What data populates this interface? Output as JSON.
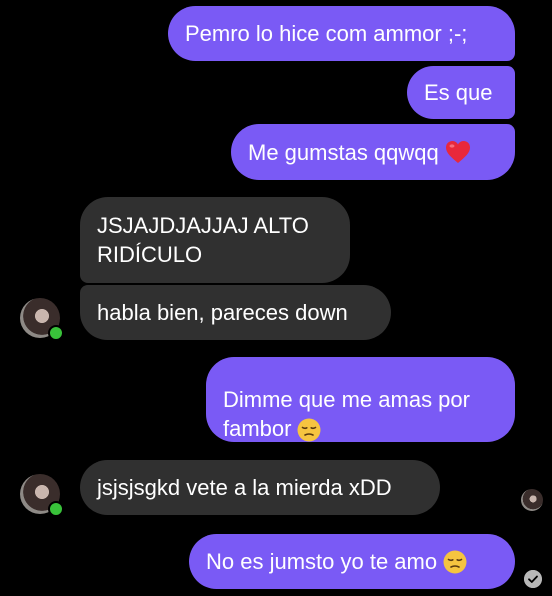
{
  "messages": {
    "m1": "Pemro lo hice com ammor ;-;",
    "m2": "Es que",
    "m3": "Me gumstas qqwqq",
    "m4": "JSJAJDJAJJAJ ALTO\nRIDÍCULO",
    "m5": "habla bien, pareces down",
    "m6": "Dimme que me amas por\nfambor",
    "m7": "jsjsjsgkd vete a la mierda xDD",
    "m8": "No es jumsto yo te amo"
  },
  "icons": {
    "heart": "red-heart-emoji",
    "pensive": "pensive-face-emoji",
    "delivered": "check-circle-icon"
  },
  "colors": {
    "sent_bubble": "#7a5af5",
    "received_bubble": "#303030",
    "background": "#000000",
    "online": "#39c23a"
  }
}
